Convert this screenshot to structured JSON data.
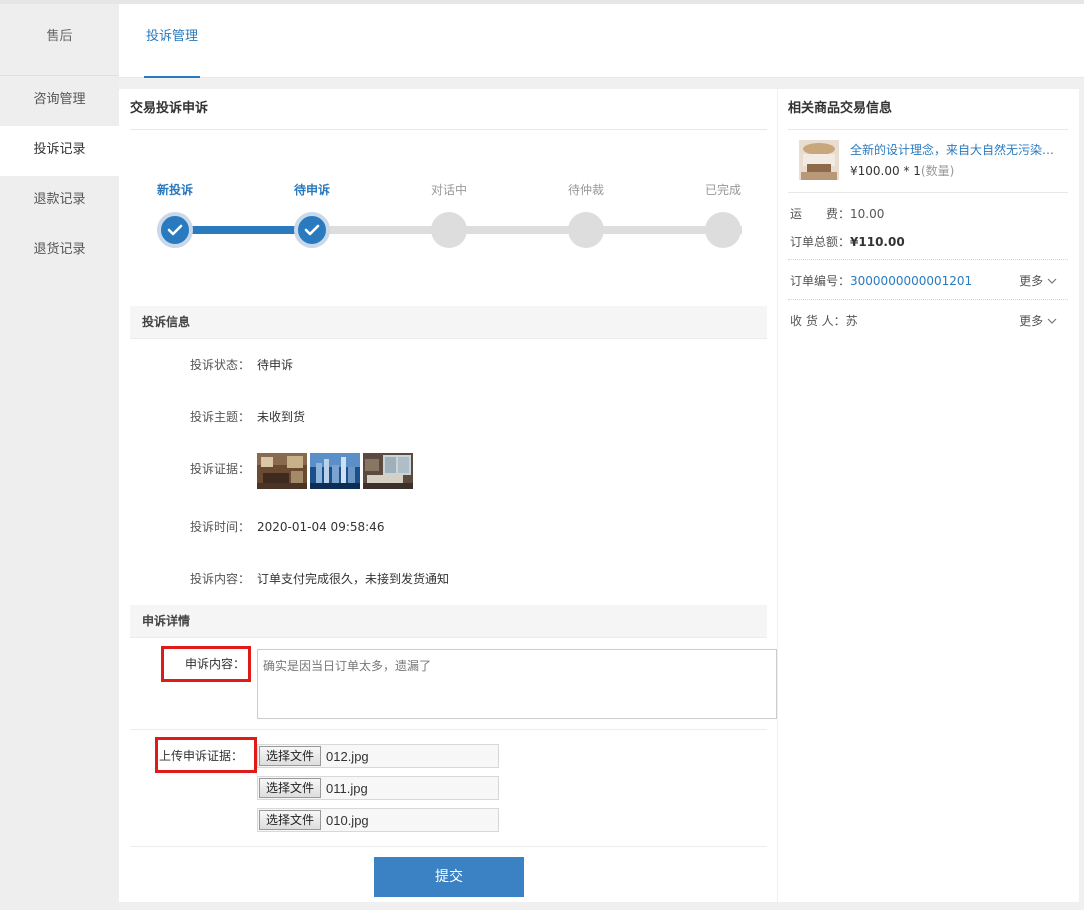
{
  "sidebar": {
    "header": "售后",
    "items": [
      {
        "label": "咨询管理",
        "active": false
      },
      {
        "label": "投诉记录",
        "active": true
      },
      {
        "label": "退款记录",
        "active": false
      },
      {
        "label": "退货记录",
        "active": false
      }
    ]
  },
  "header": {
    "tab_label": "投诉管理"
  },
  "main": {
    "title": "交易投诉申诉",
    "steps": [
      {
        "label": "新投诉",
        "done": true
      },
      {
        "label": "待申诉",
        "done": true
      },
      {
        "label": "对话中",
        "done": false
      },
      {
        "label": "待仲裁",
        "done": false
      },
      {
        "label": "已完成",
        "done": false
      }
    ],
    "complaint_info": {
      "heading": "投诉信息",
      "status_label": "投诉状态：",
      "status_value": "待申诉",
      "subject_label": "投诉主题：",
      "subject_value": "未收到货",
      "evidence_label": "投诉证据：",
      "time_label": "投诉时间：",
      "time_value": "2020-01-04 09:58:46",
      "content_label": "投诉内容：",
      "content_value": "订单支付完成很久，未接到发货通知"
    },
    "appeal": {
      "heading": "申诉详情",
      "content_label": "申诉内容：",
      "content_value": "确实是因当日订单太多，遗漏了",
      "upload_label": "上传申诉证据：",
      "file_button": "选择文件",
      "files": [
        "012.jpg",
        "011.jpg",
        "010.jpg"
      ],
      "submit_label": "提交"
    }
  },
  "side": {
    "title": "相关商品交易信息",
    "product_name": "全新的设计理念，来自大自然无污染的木材",
    "product_price": "¥100.00 * 1",
    "product_qty": "(数量)",
    "shipping_label": "运　　费：",
    "shipping_value": "10.00",
    "total_label": "订单总额：",
    "total_value": "¥110.00",
    "order_no_label": "订单编号：",
    "order_no_value": "3000000000001201",
    "receiver_label": "收 货 人：",
    "receiver_value": "苏",
    "more_label": "更多"
  },
  "colors": {
    "accent": "#2a7ac0",
    "highlight": "#e01919",
    "submit": "#3b82c4"
  }
}
